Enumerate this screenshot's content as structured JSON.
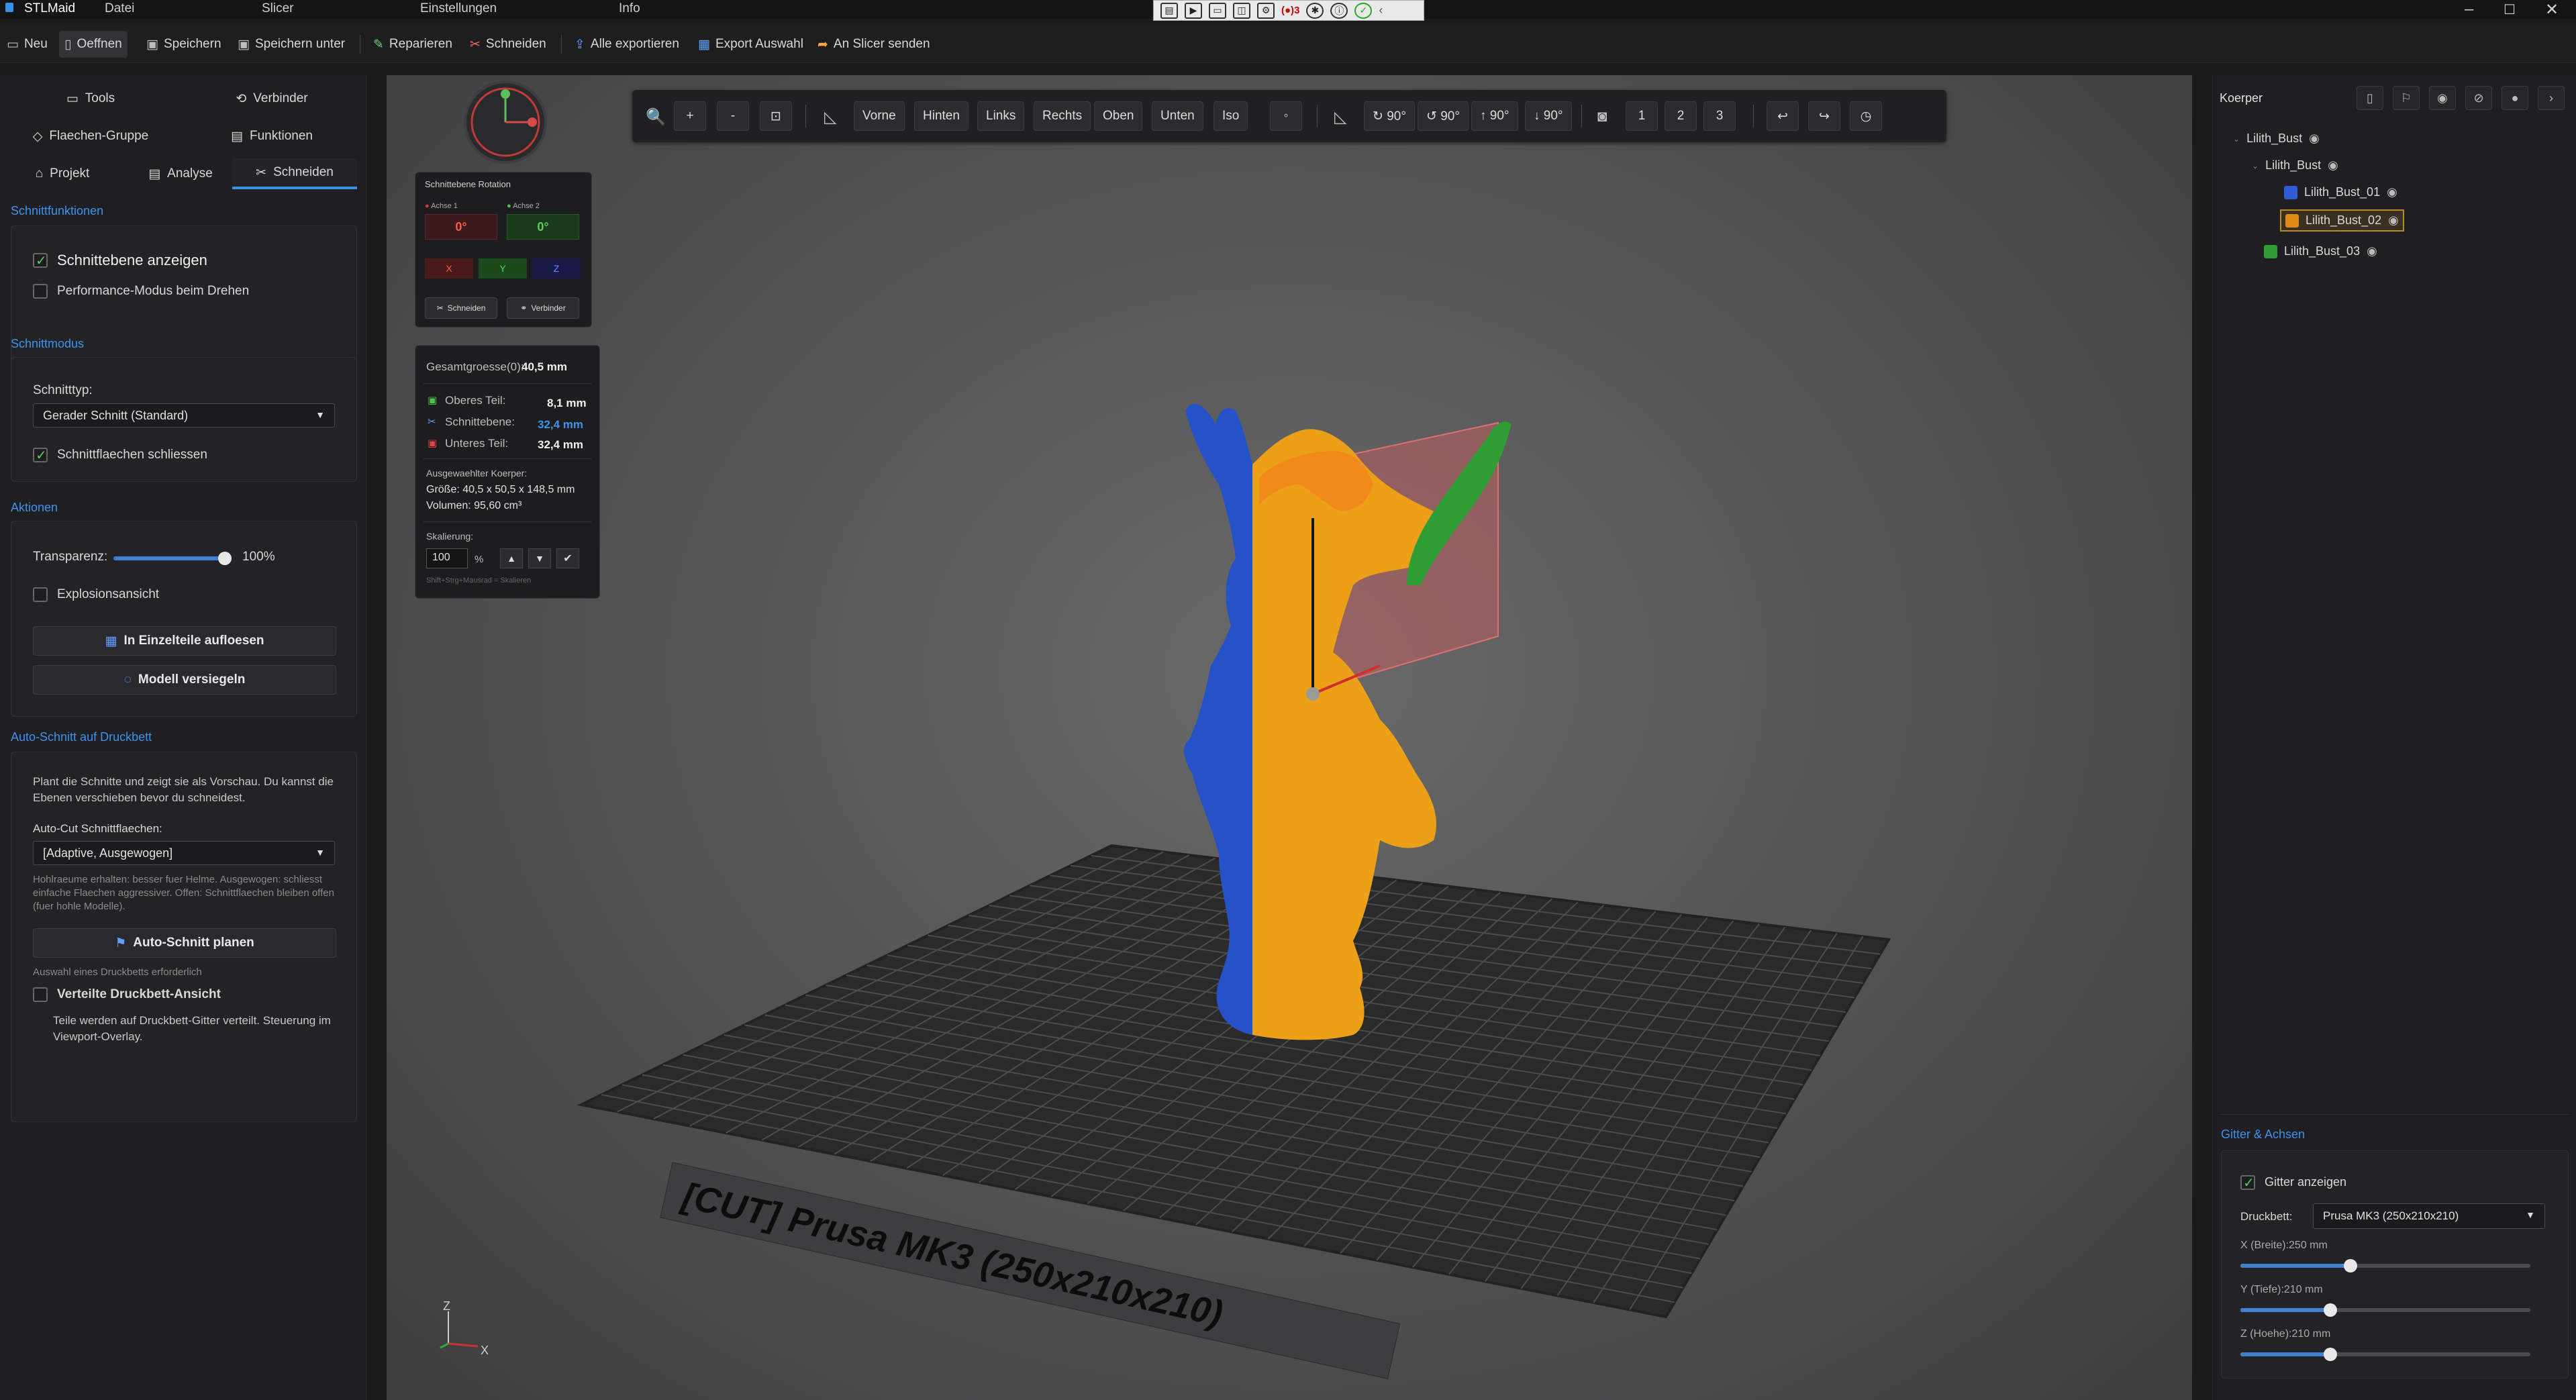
{
  "app": {
    "title": "STLMaid",
    "menu": [
      "Datei",
      "Slicer",
      "Einstellungen",
      "Info"
    ],
    "quick_badge": "3"
  },
  "toolbar": {
    "neu": "Neu",
    "oeffnen": "Oeffnen",
    "speichern": "Speichern",
    "speichern_unter": "Speichern unter",
    "reparieren": "Reparieren",
    "schneiden": "Schneiden",
    "alle_exportieren": "Alle exportieren",
    "export_auswahl": "Export Auswahl",
    "an_slicer": "An Slicer senden"
  },
  "left": {
    "tabs": {
      "tools": "Tools",
      "verbinder": "Verbinder",
      "flaechen": "Flaechen-Gruppe",
      "funktionen": "Funktionen",
      "projekt": "Projekt",
      "analyse": "Analyse",
      "schneiden": "Schneiden"
    },
    "schnittfunktionen": {
      "title": "Schnittfunktionen",
      "show_plane": "Schnittebene anzeigen",
      "performance": "Performance-Modus beim Drehen"
    },
    "schnittmodus": {
      "title": "Schnittmodus",
      "type_label": "Schnitttyp:",
      "type_value": "Gerader Schnitt (Standard)",
      "close_faces": "Schnittflaechen schliessen"
    },
    "aktionen": {
      "title": "Aktionen",
      "transparency_label": "Transparenz:",
      "transparency_value": "100%",
      "transparency_level": 1.0,
      "explosion": "Explosionsansicht",
      "split_button": "In Einzelteile aufloesen",
      "seal_button": "Modell versiegeln"
    },
    "autocut": {
      "title": "Auto-Schnitt auf Druckbett",
      "description": "Plant die Schnitte und zeigt sie als Vorschau. Du kannst die Ebenen verschieben bevor du schneidest.",
      "faces_label": "Auto-Cut Schnittflaechen:",
      "faces_value": "[Adaptive, Ausgewogen]",
      "hint": "Hohlraeume erhalten: besser fuer Helme. Ausgewogen: schliesst einfache Flaechen aggressiver. Offen: Schnittflaechen bleiben offen (fuer hohle Modelle).",
      "plan_button": "Auto-Schnitt planen",
      "plan_hint": "Auswahl eines Druckbetts erforderlich",
      "distributed": "Verteilte Druckbett-Ansicht",
      "distributed_desc": "Teile werden auf Druckbett-Gitter verteilt. Steuerung im Viewport-Overlay."
    }
  },
  "viewport": {
    "views": [
      "Vorne",
      "Hinten",
      "Links",
      "Rechts",
      "Oben",
      "Unten",
      "Iso"
    ],
    "rotations": [
      "↻ 90°",
      "↺ 90°",
      "↑ 90°",
      "↓ 90°"
    ],
    "snapshots": [
      "1",
      "2",
      "3"
    ],
    "bed_label": "[CUT] Prusa MK3 (250x210x210)",
    "axis_z": "Z",
    "axis_x": "X",
    "rotation_panel": {
      "title": "Schnittebene Rotation",
      "axis1": "Achse 1",
      "axis2": "Achse 2",
      "val1": "0°",
      "val2": "0°",
      "x": "X",
      "y": "Y",
      "z": "Z",
      "cut": "Schneiden",
      "connector": "Verbinder"
    },
    "info_panel": {
      "total_label": "Gesamtgroesse(0):",
      "total_value": "40,5 mm",
      "top_label": "Oberes Teil:",
      "top_value": "8,1 mm",
      "plane_label": "Schnittebene:",
      "plane_value": "32,4 mm",
      "bottom_label": "Unteres Teil:",
      "bottom_value": "32,4 mm",
      "selected_label": "Ausgewaehlter Koerper:",
      "size": "Größe: 40,5 x 50,5 x 148,5 mm",
      "volume": "Volumen: 95,60 cm³",
      "scale_label": "Skalierung:",
      "scale_value": "100",
      "scale_unit": "%",
      "scale_hint": "Shift+Strg+Mausrad = Skalieren"
    }
  },
  "right": {
    "title": "Koerper",
    "tree": [
      {
        "name": "Lilith_Bust",
        "level": 0
      },
      {
        "name": "Lilith_Bust",
        "level": 1
      },
      {
        "name": "Lilith_Bust_01",
        "level": 2,
        "color": "#2f5bd6"
      },
      {
        "name": "Lilith_Bust_02",
        "level": 2,
        "color": "#e08a14",
        "selected": true
      },
      {
        "name": "Lilith_Bust_03",
        "level": 1,
        "color": "#2e9d36"
      }
    ],
    "grid": {
      "title": "Gitter & Achsen",
      "show_grid": "Gitter anzeigen",
      "bed_label": "Druckbett:",
      "bed_value": "Prusa MK3 (250x210x210)",
      "x_label": "X (Breite):250 mm",
      "y_label": "Y (Tiefe):210 mm",
      "z_label": "Z (Hoehe):210 mm",
      "x_level": 0.38,
      "y_level": 0.31,
      "z_level": 0.31
    }
  }
}
